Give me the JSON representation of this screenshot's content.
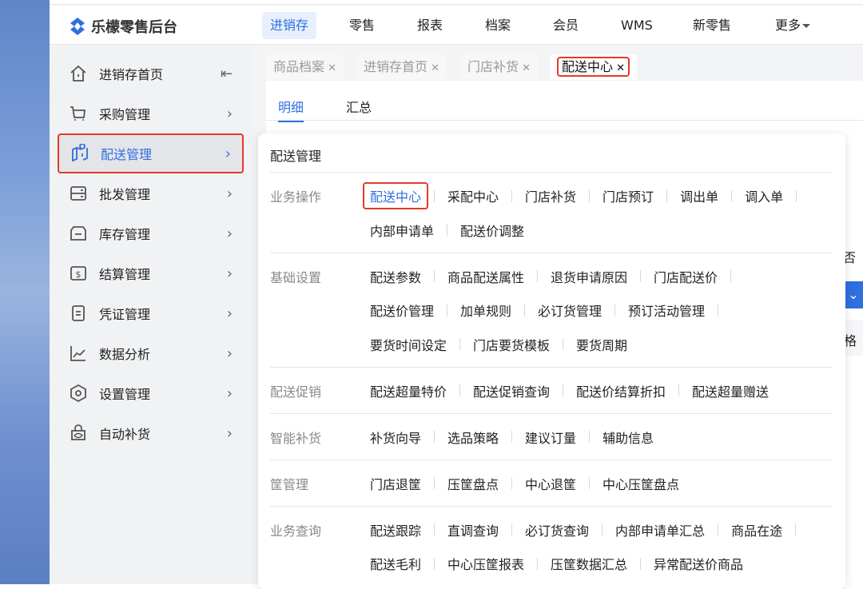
{
  "brand": {
    "name": "乐檬零售后台",
    "color": "#2f6fe0"
  },
  "nav": [
    {
      "label": "进销存",
      "active": true
    },
    {
      "label": "零售"
    },
    {
      "label": "报表"
    },
    {
      "label": "档案"
    },
    {
      "label": "会员"
    },
    {
      "label": "WMS"
    },
    {
      "label": "新零售"
    },
    {
      "label": "更多"
    }
  ],
  "sidebar": {
    "items": [
      {
        "label": "进销存首页",
        "icon": "home-icon"
      },
      {
        "label": "采购管理",
        "icon": "cart-icon"
      },
      {
        "label": "配送管理",
        "icon": "delivery-map-icon",
        "active": true
      },
      {
        "label": "批发管理",
        "icon": "wholesale-icon"
      },
      {
        "label": "库存管理",
        "icon": "inventory-icon"
      },
      {
        "label": "结算管理",
        "icon": "dollar-icon"
      },
      {
        "label": "凭证管理",
        "icon": "document-icon"
      },
      {
        "label": "数据分析",
        "icon": "chart-icon"
      },
      {
        "label": "设置管理",
        "icon": "settings-hexagon-icon"
      },
      {
        "label": "自动补货",
        "icon": "auto-replenish-icon"
      }
    ]
  },
  "tabs": [
    {
      "label": "商品档案"
    },
    {
      "label": "进销存首页"
    },
    {
      "label": "门店补货"
    },
    {
      "label": "配送中心",
      "active": true
    }
  ],
  "subtabs": [
    {
      "label": "明细",
      "active": true
    },
    {
      "label": "汇总"
    }
  ],
  "peek": {
    "text1": "否",
    "text2": "格"
  },
  "panel": {
    "title": "配送管理",
    "sections": [
      {
        "category": "业务操作",
        "lines": [
          [
            "配送中心",
            "采配中心",
            "门店补货",
            "门店预订",
            "调出单",
            "调入单"
          ],
          [
            "内部申请单",
            "配送价调整"
          ]
        ],
        "highlight": "配送中心"
      },
      {
        "category": "基础设置",
        "lines": [
          [
            "配送参数",
            "商品配送属性",
            "退货申请原因",
            "门店配送价"
          ],
          [
            "配送价管理",
            "加单规则",
            "必订货管理",
            "预订活动管理"
          ],
          [
            "要货时间设定",
            "门店要货模板",
            "要货周期"
          ]
        ]
      },
      {
        "category": "配送促销",
        "lines": [
          [
            "配送超量特价",
            "配送促销查询",
            "配送价结算折扣",
            "配送超量赠送"
          ]
        ]
      },
      {
        "category": "智能补货",
        "lines": [
          [
            "补货向导",
            "选品策略",
            "建议订量",
            "辅助信息"
          ]
        ]
      },
      {
        "category": "筐管理",
        "lines": [
          [
            "门店退筐",
            "压筐盘点",
            "中心退筐",
            "中心压筐盘点"
          ]
        ]
      },
      {
        "category": "业务查询",
        "lines": [
          [
            "配送跟踪",
            "直调查询",
            "必订货查询",
            "内部申请单汇总",
            "商品在途"
          ],
          [
            "配送毛利",
            "中心压筐报表",
            "压筐数据汇总",
            "异常配送价商品"
          ]
        ]
      }
    ]
  }
}
